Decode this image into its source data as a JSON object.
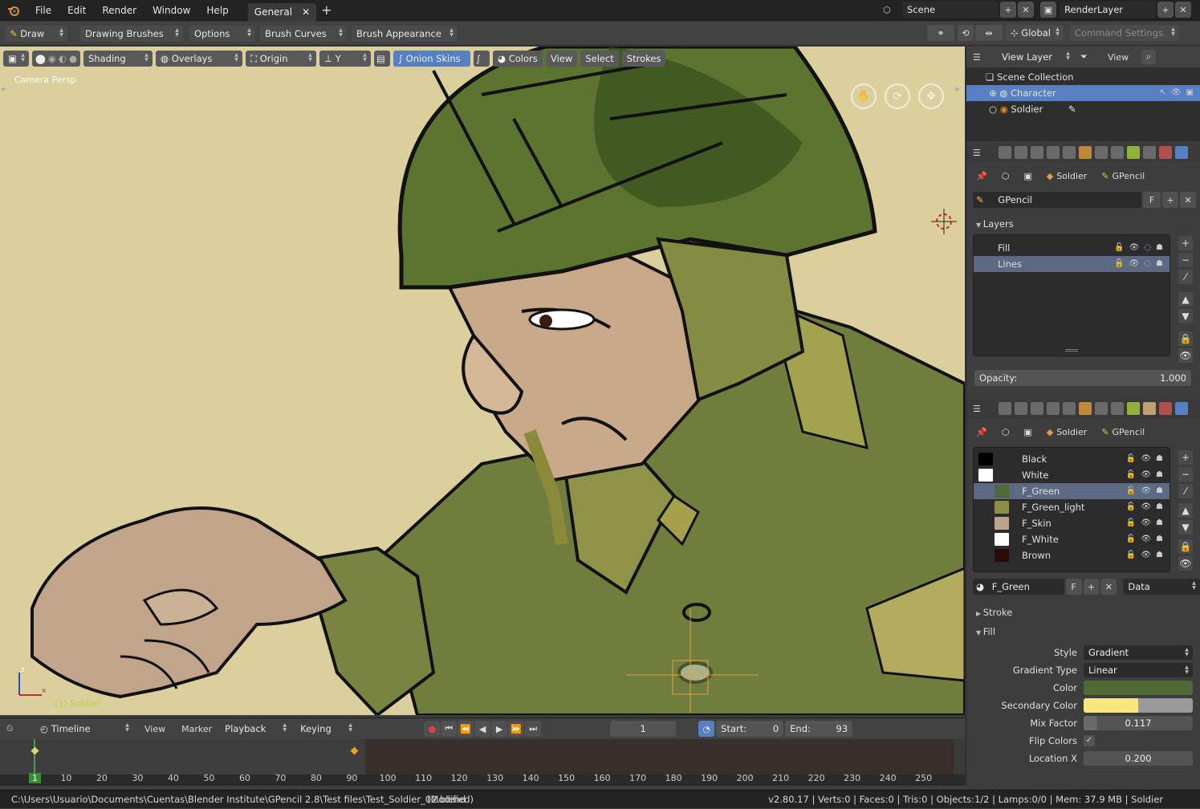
{
  "topbar": {
    "menu": [
      "File",
      "Edit",
      "Render",
      "Window",
      "Help"
    ],
    "workspace_tab": "General",
    "scene": "Scene",
    "render_layer": "RenderLayer"
  },
  "toolhdr": {
    "mode": "Draw",
    "drawing_brushes": "Drawing Brushes",
    "options": "Options",
    "brush_curves": "Brush Curves",
    "brush_appearance": "Brush Appearance",
    "orientation": "Global",
    "command_settings": "Command Settings"
  },
  "viewport": {
    "shading": "Shading",
    "overlays": "Overlays",
    "origin": "Origin",
    "axis": "Y",
    "onion_skins": "Onion Skins",
    "colors": "Colors",
    "view": "View",
    "select": "Select",
    "strokes": "Strokes",
    "camera_label": "Camera Persp",
    "object_label": "(1) Soldier",
    "axis_z": "z",
    "axis_x": "x"
  },
  "outliner": {
    "view_layer": "View Layer",
    "view": "View",
    "scene_collection": "Scene Collection",
    "items": [
      {
        "label": "Character",
        "selected": true
      },
      {
        "label": "Soldier",
        "selected": false
      }
    ]
  },
  "props1": {
    "object": "Soldier",
    "data": "GPencil",
    "datablock": "GPencil",
    "fake_user": "F",
    "layers_title": "Layers",
    "layers": [
      {
        "label": "Fill",
        "selected": false
      },
      {
        "label": "Lines",
        "selected": true
      }
    ],
    "opacity_label": "Opacity:",
    "opacity_value": "1.000"
  },
  "props2": {
    "object": "Soldier",
    "data": "GPencil",
    "materials": [
      {
        "label": "Black",
        "color": "#000000",
        "selected": false
      },
      {
        "label": "White",
        "color": "#ffffff",
        "selected": false
      },
      {
        "label": "F_Green",
        "color": "#4f6a35",
        "selected": true
      },
      {
        "label": "F_Green_light",
        "color": "#8f8e45",
        "selected": false
      },
      {
        "label": "F_Skin",
        "color": "#b9a58a",
        "selected": false
      },
      {
        "label": "F_White",
        "color": "#ffffff",
        "selected": false
      },
      {
        "label": "Brown",
        "color": "#2a0c08",
        "selected": false
      }
    ],
    "material_name": "F_Green",
    "fake_user": "F",
    "link": "Data",
    "stroke_title": "Stroke",
    "fill_title": "Fill",
    "fields": {
      "style_label": "Style",
      "style_value": "Gradient",
      "gradient_type_label": "Gradient Type",
      "gradient_type_value": "Linear",
      "color_label": "Color",
      "color_value": "#4f6a35",
      "secondary_color_label": "Secondary Color",
      "secondary_color_value": "#f7e77e",
      "mix_factor_label": "Mix Factor",
      "mix_factor_value": "0.117",
      "flip_colors_label": "Flip Colors",
      "location_x_label": "Location X",
      "location_x_value": "0.200"
    }
  },
  "timeline": {
    "editor": "Timeline",
    "view": "View",
    "marker": "Marker",
    "playback": "Playback",
    "keying": "Keying",
    "current_frame": "1",
    "start_label": "Start:",
    "start_value": "0",
    "end_label": "End:",
    "end_value": "93",
    "ruler": [
      "1",
      "10",
      "20",
      "30",
      "40",
      "50",
      "60",
      "70",
      "80",
      "90",
      "100",
      "110",
      "120",
      "130",
      "140",
      "150",
      "160",
      "170",
      "180",
      "190",
      "200",
      "210",
      "220",
      "230",
      "240",
      "250"
    ]
  },
  "status": {
    "path": "C:\\Users\\Usuario\\Documents\\Cuentas\\Blender Institute\\GPencil 2.8\\Test files\\Test_Soldier_02.blend",
    "modified": "(Modified)",
    "stats": "v2.80.17 | Verts:0 | Faces:0 | Tris:0 | Objects:1/2 | Lamps:0/0 | Mem: 37.9 MB | Soldier"
  }
}
